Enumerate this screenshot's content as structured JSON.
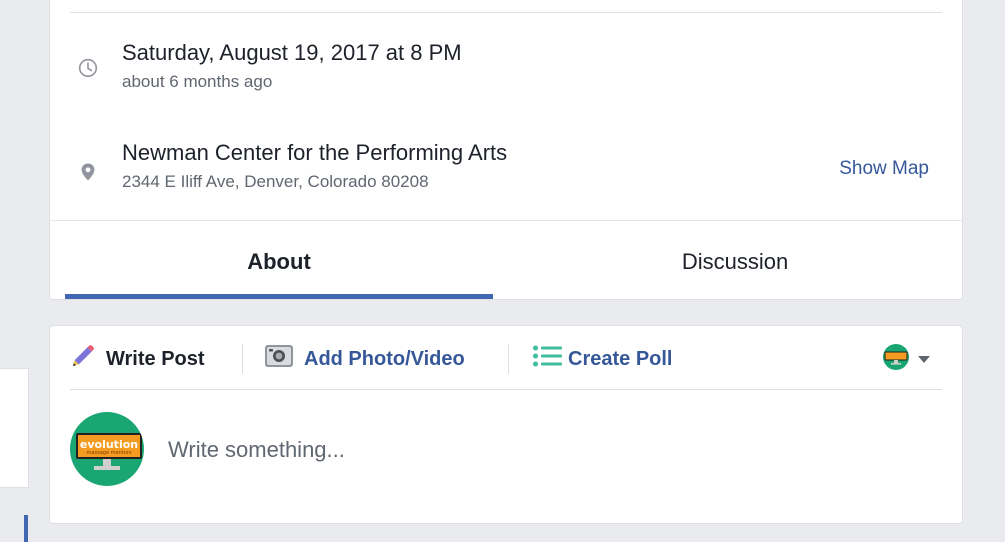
{
  "event": {
    "datetime_title": "Saturday, August 19, 2017 at 8 PM",
    "datetime_relative": "about 6 months ago",
    "venue_name": "Newman Center for the Performing Arts",
    "venue_address": "2344 E Iliff Ave, Denver, Colorado 80208",
    "show_map_label": "Show Map"
  },
  "tabs": [
    {
      "label": "About",
      "active": true
    },
    {
      "label": "Discussion",
      "active": false
    }
  ],
  "composer": {
    "actions": [
      {
        "label": "Write Post",
        "icon": "pencil-icon"
      },
      {
        "label": "Add Photo/Video",
        "icon": "camera-icon"
      },
      {
        "label": "Create Poll",
        "icon": "poll-list-icon"
      }
    ],
    "placeholder": "Write something...",
    "avatar_brand": "evolution",
    "avatar_tagline": "massage mentors"
  },
  "icons": {
    "time": "clock-icon",
    "location": "map-pin-icon",
    "audience": "audience-selector-icon"
  },
  "colors": {
    "page_bg": "#e9ebee",
    "link": "#365899",
    "accent": "#4267b2",
    "text": "#1d2129",
    "muted": "#606770",
    "avatar_green": "#1aa672",
    "avatar_orange": "#f39c21"
  }
}
